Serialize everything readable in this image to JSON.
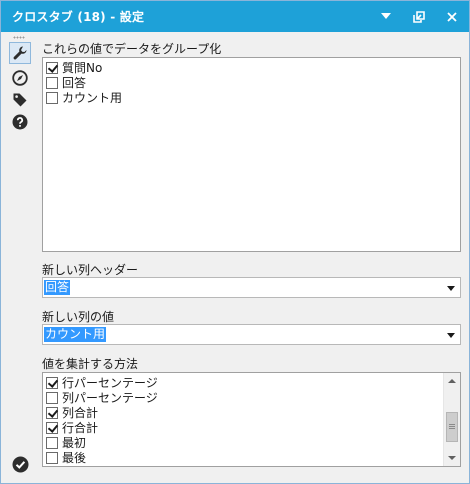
{
  "window": {
    "title": "クロスタブ (18) - 設定",
    "buttons": {
      "menu": "chevron-down-icon",
      "undock": "undock-icon",
      "close": "close-icon"
    }
  },
  "sidebar": {
    "items": [
      {
        "name": "configuration",
        "icon": "wrench-icon",
        "active": true
      },
      {
        "name": "navigation",
        "icon": "compass-icon",
        "active": false
      },
      {
        "name": "annotation",
        "icon": "tag-icon",
        "active": false
      },
      {
        "name": "help",
        "icon": "help-icon",
        "active": false
      }
    ],
    "status_icon": "check-circle-icon"
  },
  "group_by": {
    "label": "これらの値でデータをグループ化",
    "items": [
      {
        "label": "質問No",
        "checked": true
      },
      {
        "label": "回答",
        "checked": false
      },
      {
        "label": "カウント用",
        "checked": false
      }
    ]
  },
  "new_column_header": {
    "label": "新しい列ヘッダー",
    "value": "回答"
  },
  "new_column_value": {
    "label": "新しい列の値",
    "value": "カウント用"
  },
  "aggregation": {
    "label": "値を集計する方法",
    "items": [
      {
        "label": "行パーセンテージ",
        "checked": true
      },
      {
        "label": "列パーセンテージ",
        "checked": false
      },
      {
        "label": "列合計",
        "checked": true
      },
      {
        "label": "行合計",
        "checked": true
      },
      {
        "label": "最初",
        "checked": false
      },
      {
        "label": "最後",
        "checked": false
      }
    ],
    "scroll_position": 0.75
  },
  "colors": {
    "titlebar": "#1ea1d8",
    "selection": "#3399ff",
    "panel": "#f0f0f0"
  }
}
